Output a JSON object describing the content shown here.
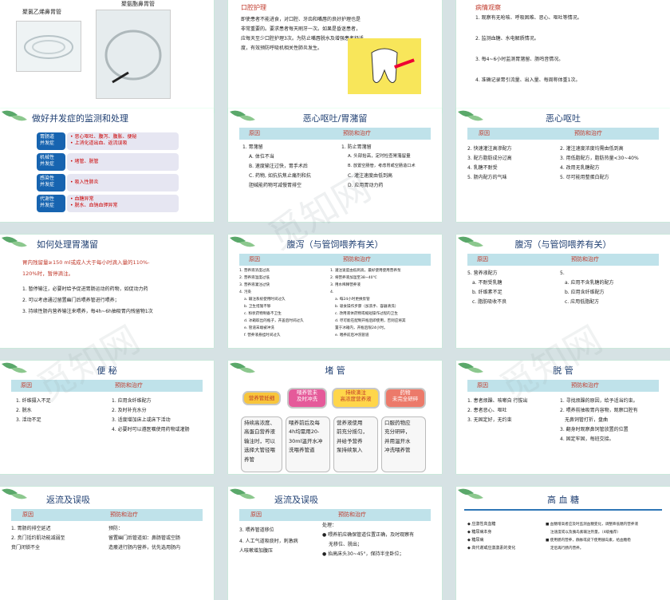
{
  "s1": {
    "label_a": "聚氯乙烯鼻胃管",
    "label_b": "聚氨酯鼻胃管"
  },
  "s2": {
    "title": "口腔护理",
    "body": [
      "即使患者不能进食，对口腔、牙齿和嘴唇的良好护理也是",
      "非常重要的。要求患者每天刷牙一次。如果是昏迷患者，",
      "应每天至少口腔护理3次。为防止嘴唇脱水及增强患者舒适",
      "度，有效预防呼吸机相关性肺炎发生。"
    ]
  },
  "s3": {
    "title": "病情观察",
    "items": [
      "1. 观察有无呛咳、呼吸困难、恶心、呕吐等情况。",
      "2. 监测血糖、水电解质情况。",
      "3. 每4~6小时监测胃潴留、肠鸣音情况。",
      "4. 准确记录胃引流量、出入量、每周称体重1次。"
    ]
  },
  "s4": {
    "title": "做好并发症的监测和处理",
    "rows": [
      {
        "left": "胃肠道\n并发症",
        "right": "• 恶心呕吐、腹泻、腹胀、便秘\n• 上消化道出血、返流误吸"
      },
      {
        "left": "机械性\n并发症",
        "right": "• 堵管、脱管"
      },
      {
        "left": "感染性\n并发症",
        "right": "• 吸入性肺炎"
      },
      {
        "left": "代谢性\n并发症",
        "right": "• 血糖异常\n• 脱水、血钠血钾异常"
      }
    ]
  },
  "s5": {
    "title": "恶心呕吐/胃潴留",
    "h1": "原因",
    "h2": "预防和治疗",
    "left": [
      "1. 胃潴留",
      "A. 体位不当",
      "B. 速度输注过快，胃手术后",
      "C. 药物, 如抗抗焦止痛剂和抗",
      "胆碱能药物可减慢胃排空"
    ],
    "right": [
      "1. 防止胃潴留",
      "A. 头部抬高，定时检查胃潴留量",
      "B. 放置空肠管，考虑胃或空肠造口术",
      "C. 灌注速度由低到高",
      "D. 应用胃动力药"
    ]
  },
  "s6": {
    "title": "恶心呕吐",
    "h1": "原因",
    "h2": "预防和治疗",
    "left": [
      "2. 快速灌注高渗配方",
      "3. 配方脂肪成分过高",
      "4. 乳糖不耐受",
      "5. 肠内配方的气味"
    ],
    "right": [
      "2. 灌注速度浓度均需由低到高",
      "3. 用低脂配方，脂肪热量<30~40%",
      "4. 改用无乳糖配方",
      "5. 尽可能用整蛋白配方"
    ]
  },
  "s7": {
    "title": "如何处理胃潴留",
    "highlight": [
      "胃内残留量≥150 ml或成人大于每小时滴入量的110%-",
      "120%时，暂停滴注。"
    ],
    "items": [
      "1. 暂停输注，必要时给予促进胃肠运动的药物，如促动力药",
      "2. 可以考虑通过留置幽门后喂养管进行喂养；",
      "3. 持续性肠内营养输注来喂养，每4h~6h抽吸胃内残留物1次"
    ]
  },
  "s8": {
    "title": "腹泻（与管饲喂养有关）",
    "h1": "原因",
    "h2": "预防和治疗",
    "left": [
      "1. 营养液浓度过高",
      "2. 营养液温度过低",
      "3. 营养液灌注过快",
      "4. 污染",
      "a. 输注系统使用时间过久",
      "b. 卫生措施不够",
      "c. 粉状药物制备不卫生",
      "d. 冰箱取出的瓶子，开盖后时间过久",
      "e. 管道末端被冲洗",
      "f. 营养液悬挂时间过久"
    ],
    "right": [
      "1. 灌注速度由低到高，最好使用使用营养泵",
      "2. 将营养液加温至38~40℃",
      "3. 用水稀释营养液",
      "4.",
      "a. 每24小时更换泵管",
      "b. 吸食操作步骤（加洗手、容器清洗）",
      "c. 改用液体药物或缩短操作过程的卫生",
      "d. 尽可能在配制开瓶后即使用，否则应将其",
      "置于冰箱内，开瓶后限24小时。",
      "e. 喂养前后冲洗管道"
    ]
  },
  "s9": {
    "title": "腹泻（与管饲喂养有关）",
    "h1": "原因",
    "h2": "预防和治疗",
    "left": [
      "5. 营养液配方",
      "a. 不耐受乳糖",
      "b. 纤维素不足",
      "c. 脂肪吸收不良"
    ],
    "right": [
      "5.",
      "a. 应用不含乳糖的配方",
      "b. 应用含纤维配方",
      "c. 应用低脂配方"
    ]
  },
  "s10": {
    "title": "便 秘",
    "h1": "原因",
    "h2": "预防和治疗",
    "left": [
      "1. 纤维摄入不足",
      "2. 脱水",
      "3. 活动不足"
    ],
    "right": [
      "1. 应用含纤维配方",
      "2. 及时补充水分",
      "3. 适度增加床上或床下活动",
      "4. 必要时可以遵医嘱使用药物或灌肠"
    ]
  },
  "s11": {
    "title": "堵 管",
    "pills": [
      "营养管妊细",
      "喂养管未\n及时冲洗",
      "持续滴注\n高浓度营养液",
      "药物\n未完全研碎"
    ],
    "cards": [
      "持续高浓度、\n高蛋白营养液\n输注时，可以\n选择大管径喂\n养管",
      "喂养前后及每\n4h均需用20-\n30ml温开水冲\n洗喂养管道",
      "营养液使用\n前充分摇匀，\n并给予营养\n泵持续泵入",
      "口服药物应\n充分研碎，\n并用温开水\n冲洗喂养管"
    ]
  },
  "s12": {
    "title": "脱 管",
    "h1": "原因",
    "h2": "预防和治疗",
    "left": [
      "1. 患者烦躁、咳嗽自    行拔出",
      "2. 患者恶心、呕吐",
      "3. 无固定好，无约束"
    ],
    "right": [
      "1. 寻找烦躁的原因，给予适当约束。",
      "2. 喂养前抽吸胃内容物，观察口腔有",
      "无鼻饲管打折，盘曲",
      "3. 翻身时观察鼻饲管放置的位置",
      "4. 固定牢固，每班交接。"
    ]
  },
  "s13": {
    "title": "返流及误吸",
    "h1": "原因",
    "h2": "预防和治疗",
    "left": [
      "1. 胃肠的排空延迟",
      "2. 贲门括约肌功能减弱至",
      "贲门闭锁不全"
    ],
    "right": [
      "预防：",
      "留置幽门后管道如：鼻肠管或空肠",
      "造瘘进行肠内营养，优先选用肠内"
    ]
  },
  "s14": {
    "title": "返流及误吸",
    "h1": "原因",
    "h2": "预防和治疗",
    "left": [
      "3. 喂养管道移位",
      "4. 人工气道吸痰时，刺激病",
      "人咳嗽增加腹压"
    ],
    "right": [
      "处理：",
      "● 喂养前应确保管道位置正确，及时观察有",
      "无移位、脱出；",
      "● 抬高床头30~45°，保持半坐卧位；"
    ]
  },
  "s15": {
    "title": "高 血 糖",
    "left": [
      "◆ 应激性高血糖",
      "◆ 糖尿病本身",
      "◆ 糖尿病",
      "◆ 高代谢或应激激素的变化"
    ],
    "right": [
      "■ 血糖增高者应及时监测血糖变化，调整降低糖内营养液",
      "注速度或以及胰岛素输注剂量。（4级推荐）",
      "■ 使用肠内营养，静脉或皮下使用胰岛素，给血糖稳",
      "定后再行肠内营养。"
    ]
  },
  "watermark": "觅知网"
}
